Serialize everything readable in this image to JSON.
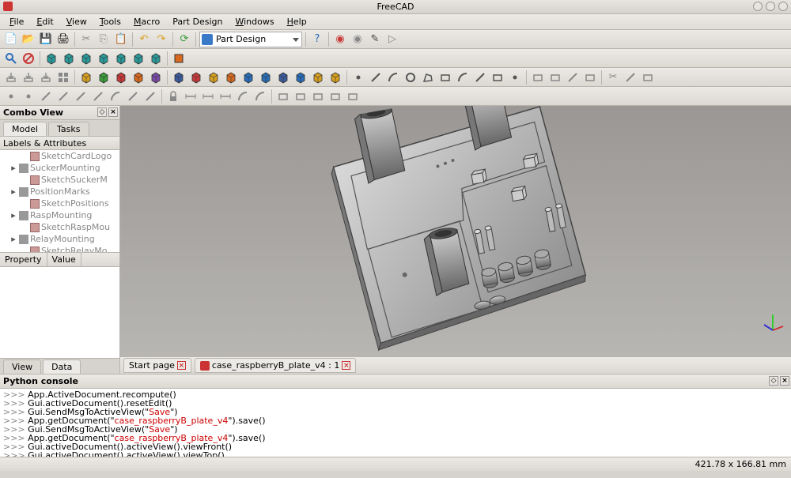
{
  "app_title": "FreeCAD",
  "menu": {
    "file": "File",
    "edit": "Edit",
    "view": "View",
    "tools": "Tools",
    "macro": "Macro",
    "part_design": "Part Design",
    "windows": "Windows",
    "help": "Help"
  },
  "workbench": {
    "selected": "Part Design"
  },
  "combo_view": {
    "title": "Combo View",
    "tabs": {
      "model": "Model",
      "tasks": "Tasks"
    },
    "tree_header": "Labels & Attributes",
    "tree": [
      {
        "label": "SketchCardLogo",
        "icon": "sketch",
        "indent": 1,
        "exp": ""
      },
      {
        "label": "SuckerMounting",
        "icon": "cube",
        "indent": 0,
        "exp": "▸"
      },
      {
        "label": "SketchSuckerM",
        "icon": "sketch",
        "indent": 1,
        "exp": ""
      },
      {
        "label": "PositionMarks",
        "icon": "cube",
        "indent": 0,
        "exp": "▸"
      },
      {
        "label": "SketchPositions",
        "icon": "sketch",
        "indent": 1,
        "exp": ""
      },
      {
        "label": "RaspMounting",
        "icon": "cube",
        "indent": 0,
        "exp": "▸"
      },
      {
        "label": "SketchRaspMou",
        "icon": "sketch",
        "indent": 1,
        "exp": ""
      },
      {
        "label": "RelayMounting",
        "icon": "cube",
        "indent": 0,
        "exp": "▸"
      },
      {
        "label": "SketchRelayMo",
        "icon": "sketch",
        "indent": 1,
        "exp": ""
      }
    ],
    "property": "Property",
    "value": "Value",
    "bottom_tabs": {
      "view": "View",
      "data": "Data"
    }
  },
  "view_tabs": {
    "start": "Start page",
    "doc": "case_raspberryB_plate_v4 : 1"
  },
  "python_console": {
    "title": "Python console",
    "lines": [
      {
        "pre": ">>> ",
        "body": "App.ActiveDocument.recompute()"
      },
      {
        "pre": ">>> ",
        "body": "Gui.activeDocument().resetEdit()"
      },
      {
        "pre": ">>> ",
        "body": "Gui.SendMsgToActiveView(\"Save\")",
        "hl": true
      },
      {
        "pre": ">>> ",
        "body": "App.getDocument(\"case_raspberryB_plate_v4\").save()",
        "hl": true
      },
      {
        "pre": ">>> ",
        "body": "Gui.SendMsgToActiveView(\"Save\")",
        "hl": true
      },
      {
        "pre": ">>> ",
        "body": "App.getDocument(\"case_raspberryB_plate_v4\").save()",
        "hl": true
      },
      {
        "pre": ">>> ",
        "body": "Gui.activeDocument().activeView().viewFront()"
      },
      {
        "pre": ">>> ",
        "body": "Gui.activeDocument().activeView().viewTop()"
      },
      {
        "pre": ">>> ",
        "body": ""
      }
    ]
  },
  "status": {
    "coords": "421.78 x 166.81 mm"
  },
  "toolbar1_icons": [
    {
      "name": "new-file-icon",
      "glyph": "📄",
      "color": ""
    },
    {
      "name": "open-file-icon",
      "glyph": "📂",
      "color": ""
    },
    {
      "name": "save-icon",
      "glyph": "💾",
      "color": ""
    },
    {
      "name": "print-icon",
      "glyph": "🖨",
      "color": ""
    },
    {
      "name": "sep"
    },
    {
      "name": "cut-icon",
      "glyph": "✂",
      "color": "#888"
    },
    {
      "name": "copy-icon",
      "glyph": "⎘",
      "color": "#888"
    },
    {
      "name": "paste-icon",
      "glyph": "📋",
      "color": "#888"
    },
    {
      "name": "sep"
    },
    {
      "name": "undo-icon",
      "glyph": "↶",
      "color": "#d8a020"
    },
    {
      "name": "redo-icon",
      "glyph": "↷",
      "color": "#d8a020"
    },
    {
      "name": "sep"
    },
    {
      "name": "refresh-icon",
      "glyph": "⟳",
      "color": "#3a9c3a"
    },
    {
      "name": "sep"
    },
    {
      "name": "workbench-dropdown"
    },
    {
      "name": "sep"
    },
    {
      "name": "help-icon",
      "glyph": "?",
      "color": "#2a6db8"
    },
    {
      "name": "sep"
    },
    {
      "name": "record-icon",
      "glyph": "◉",
      "color": "#c83a3a"
    },
    {
      "name": "stop-icon",
      "glyph": "◉",
      "color": "#888"
    },
    {
      "name": "edit-macro-icon",
      "glyph": "✎",
      "color": "#444"
    },
    {
      "name": "run-macro-icon",
      "glyph": "▷",
      "color": "#888"
    }
  ],
  "toolbar2_icons": [
    {
      "name": "fit-all-icon",
      "svg": "zoom",
      "color": "#2a6db8"
    },
    {
      "name": "draw-style-icon",
      "svg": "no",
      "color": "#c83a3a"
    },
    {
      "name": "sep"
    },
    {
      "name": "iso-icon",
      "svg": "cube",
      "color": "#2a9a9a"
    },
    {
      "name": "front-icon",
      "svg": "cube",
      "color": "#2a9a9a"
    },
    {
      "name": "top-icon",
      "svg": "cube",
      "color": "#2a9a9a"
    },
    {
      "name": "right-icon",
      "svg": "cube",
      "color": "#2a9a9a"
    },
    {
      "name": "rear-icon",
      "svg": "cube",
      "color": "#2a9a9a"
    },
    {
      "name": "bottom-icon",
      "svg": "cube",
      "color": "#2a9a9a"
    },
    {
      "name": "left-icon",
      "svg": "cube",
      "color": "#2a9a9a"
    },
    {
      "name": "sep"
    },
    {
      "name": "measure-icon",
      "svg": "box",
      "color": "#d86a20"
    }
  ],
  "toolbar3_icons": [
    {
      "name": "part-import-icon",
      "svg": "tray",
      "color": "#888"
    },
    {
      "name": "part-export-icon",
      "svg": "tray",
      "color": "#888"
    },
    {
      "name": "part-down-icon",
      "svg": "tray",
      "color": "#888"
    },
    {
      "name": "part-grid-icon",
      "svg": "grid",
      "color": "#888"
    },
    {
      "name": "sep"
    },
    {
      "name": "part-box-icon",
      "svg": "cube",
      "color": "#d8a020"
    },
    {
      "name": "part-cyl-icon",
      "svg": "cube",
      "color": "#3a9c3a"
    },
    {
      "name": "part-sphere-icon",
      "svg": "cube",
      "color": "#c83a3a"
    },
    {
      "name": "part-cone-icon",
      "svg": "cube",
      "color": "#d86a20"
    },
    {
      "name": "part-torus-icon",
      "svg": "cube",
      "color": "#7a4aa8"
    },
    {
      "name": "sep"
    },
    {
      "name": "pad-icon",
      "svg": "cube",
      "color": "#3a5a9c"
    },
    {
      "name": "pocket-icon",
      "svg": "cube",
      "color": "#c83a3a"
    },
    {
      "name": "rev-icon",
      "svg": "cube",
      "color": "#d8a020"
    },
    {
      "name": "groove-icon",
      "svg": "cube",
      "color": "#d86a20"
    },
    {
      "name": "fillet-icon",
      "svg": "cube",
      "color": "#2a6db8"
    },
    {
      "name": "chamfer-icon",
      "svg": "cube",
      "color": "#2a6db8"
    },
    {
      "name": "mirror-icon",
      "svg": "cube",
      "color": "#3a5a9c"
    },
    {
      "name": "linear-icon",
      "svg": "cube",
      "color": "#2a6db8"
    },
    {
      "name": "polar-icon",
      "svg": "cube",
      "color": "#d8a020"
    },
    {
      "name": "multi-icon",
      "svg": "cube",
      "color": "#d8a020"
    },
    {
      "name": "sep"
    },
    {
      "name": "sketch-dot-icon",
      "svg": "dot",
      "color": "#555"
    },
    {
      "name": "sketch-line-icon",
      "svg": "line",
      "color": "#555"
    },
    {
      "name": "sketch-arc-icon",
      "svg": "arc",
      "color": "#555"
    },
    {
      "name": "sketch-circle-icon",
      "svg": "circ",
      "color": "#555"
    },
    {
      "name": "sketch-poly-icon",
      "svg": "poly",
      "color": "#555"
    },
    {
      "name": "sketch-rect-icon",
      "svg": "rect",
      "color": "#555"
    },
    {
      "name": "sketch-fillet-icon",
      "svg": "arc",
      "color": "#555"
    },
    {
      "name": "sketch-trim-icon",
      "svg": "line",
      "color": "#555"
    },
    {
      "name": "sketch-ext-icon",
      "svg": "rect",
      "color": "#555"
    },
    {
      "name": "sketch-con-icon",
      "svg": "dot",
      "color": "#555"
    },
    {
      "name": "sep"
    },
    {
      "name": "sketch-misc1-icon",
      "svg": "rect",
      "color": "#888"
    },
    {
      "name": "sketch-misc2-icon",
      "svg": "rect",
      "color": "#888"
    },
    {
      "name": "sketch-misc3-icon",
      "svg": "line",
      "color": "#888"
    },
    {
      "name": "sketch-misc4-icon",
      "svg": "rect",
      "color": "#888"
    },
    {
      "name": "sep"
    },
    {
      "name": "sketch-cut-icon",
      "glyph": "✂",
      "color": "#888"
    },
    {
      "name": "sketch-ax-icon",
      "svg": "line",
      "color": "#888"
    },
    {
      "name": "sketch-clip-icon",
      "svg": "rect",
      "color": "#888"
    }
  ],
  "toolbar4_icons": [
    {
      "name": "c-coincident-icon",
      "svg": "dot",
      "color": "#888"
    },
    {
      "name": "c-point-icon",
      "svg": "dot",
      "color": "#888"
    },
    {
      "name": "c-vert-icon",
      "svg": "line",
      "color": "#888"
    },
    {
      "name": "c-horz-icon",
      "svg": "line",
      "color": "#888"
    },
    {
      "name": "c-para-icon",
      "svg": "line",
      "color": "#888"
    },
    {
      "name": "c-perp-icon",
      "svg": "line",
      "color": "#888"
    },
    {
      "name": "c-tan-icon",
      "svg": "arc",
      "color": "#888"
    },
    {
      "name": "c-eq-icon",
      "svg": "line",
      "color": "#888"
    },
    {
      "name": "c-sym-icon",
      "svg": "line",
      "color": "#888"
    },
    {
      "name": "sep"
    },
    {
      "name": "c-lock-icon",
      "svg": "lock",
      "color": "#888"
    },
    {
      "name": "c-hdist-icon",
      "svg": "dim",
      "color": "#888"
    },
    {
      "name": "c-vdist-icon",
      "svg": "dim",
      "color": "#888"
    },
    {
      "name": "c-dist-icon",
      "svg": "dim",
      "color": "#888"
    },
    {
      "name": "c-rad-icon",
      "svg": "arc",
      "color": "#888"
    },
    {
      "name": "c-ang-icon",
      "svg": "arc",
      "color": "#888"
    },
    {
      "name": "sep"
    },
    {
      "name": "c-new-icon",
      "svg": "rect",
      "color": "#888"
    },
    {
      "name": "c-edit-icon",
      "svg": "rect",
      "color": "#888"
    },
    {
      "name": "c-leave-icon",
      "svg": "rect",
      "color": "#888"
    },
    {
      "name": "c-view-icon",
      "svg": "rect",
      "color": "#888"
    },
    {
      "name": "c-map-icon",
      "svg": "rect",
      "color": "#888"
    }
  ]
}
